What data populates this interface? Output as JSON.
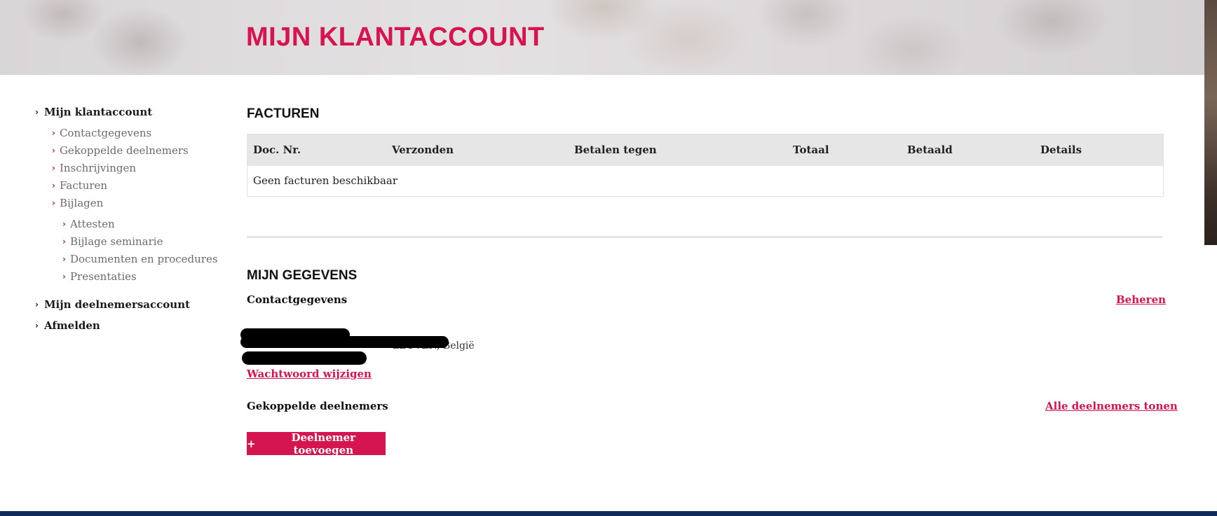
{
  "header": {
    "title": "MIJN KLANTACCOUNT"
  },
  "sidebar": {
    "items": [
      {
        "label": "Mijn klantaccount",
        "level": 1
      },
      {
        "label": "Contactgegevens",
        "level": 2
      },
      {
        "label": "Gekoppelde deelnemers",
        "level": 2
      },
      {
        "label": "Inschrijvingen",
        "level": 2
      },
      {
        "label": "Facturen",
        "level": 2
      },
      {
        "label": "Bijlagen",
        "level": 2
      },
      {
        "label": "Attesten",
        "level": 3
      },
      {
        "label": "Bijlage seminarie",
        "level": 3
      },
      {
        "label": "Documenten en procedures",
        "level": 3
      },
      {
        "label": "Presentaties",
        "level": 3
      },
      {
        "label": "Mijn deelnemersaccount",
        "level": 1
      },
      {
        "label": "Afmelden",
        "level": 1
      }
    ]
  },
  "invoices": {
    "title": "FACTUREN",
    "columns": [
      "Doc. Nr.",
      "Verzonden",
      "Betalen tegen",
      "Totaal",
      "Betaald",
      "Details"
    ],
    "empty_message": "Geen facturen beschikbaar"
  },
  "details": {
    "title": "MIJN GEGEVENS",
    "contact_label": "Contactgegevens",
    "manage_link": "Beheren",
    "address_visible": "LEUVEN, België",
    "change_password_link": "Wachtwoord wijzigen",
    "linked_label": "Gekoppelde deelnemers",
    "show_all_link": "Alle deelnemers tonen",
    "add_button": "Deelnemer toevoegen",
    "add_icon": "+"
  },
  "colors": {
    "accent": "#d5154f",
    "footer": "#0f2b5a",
    "table_header": "#e6e6e6"
  }
}
